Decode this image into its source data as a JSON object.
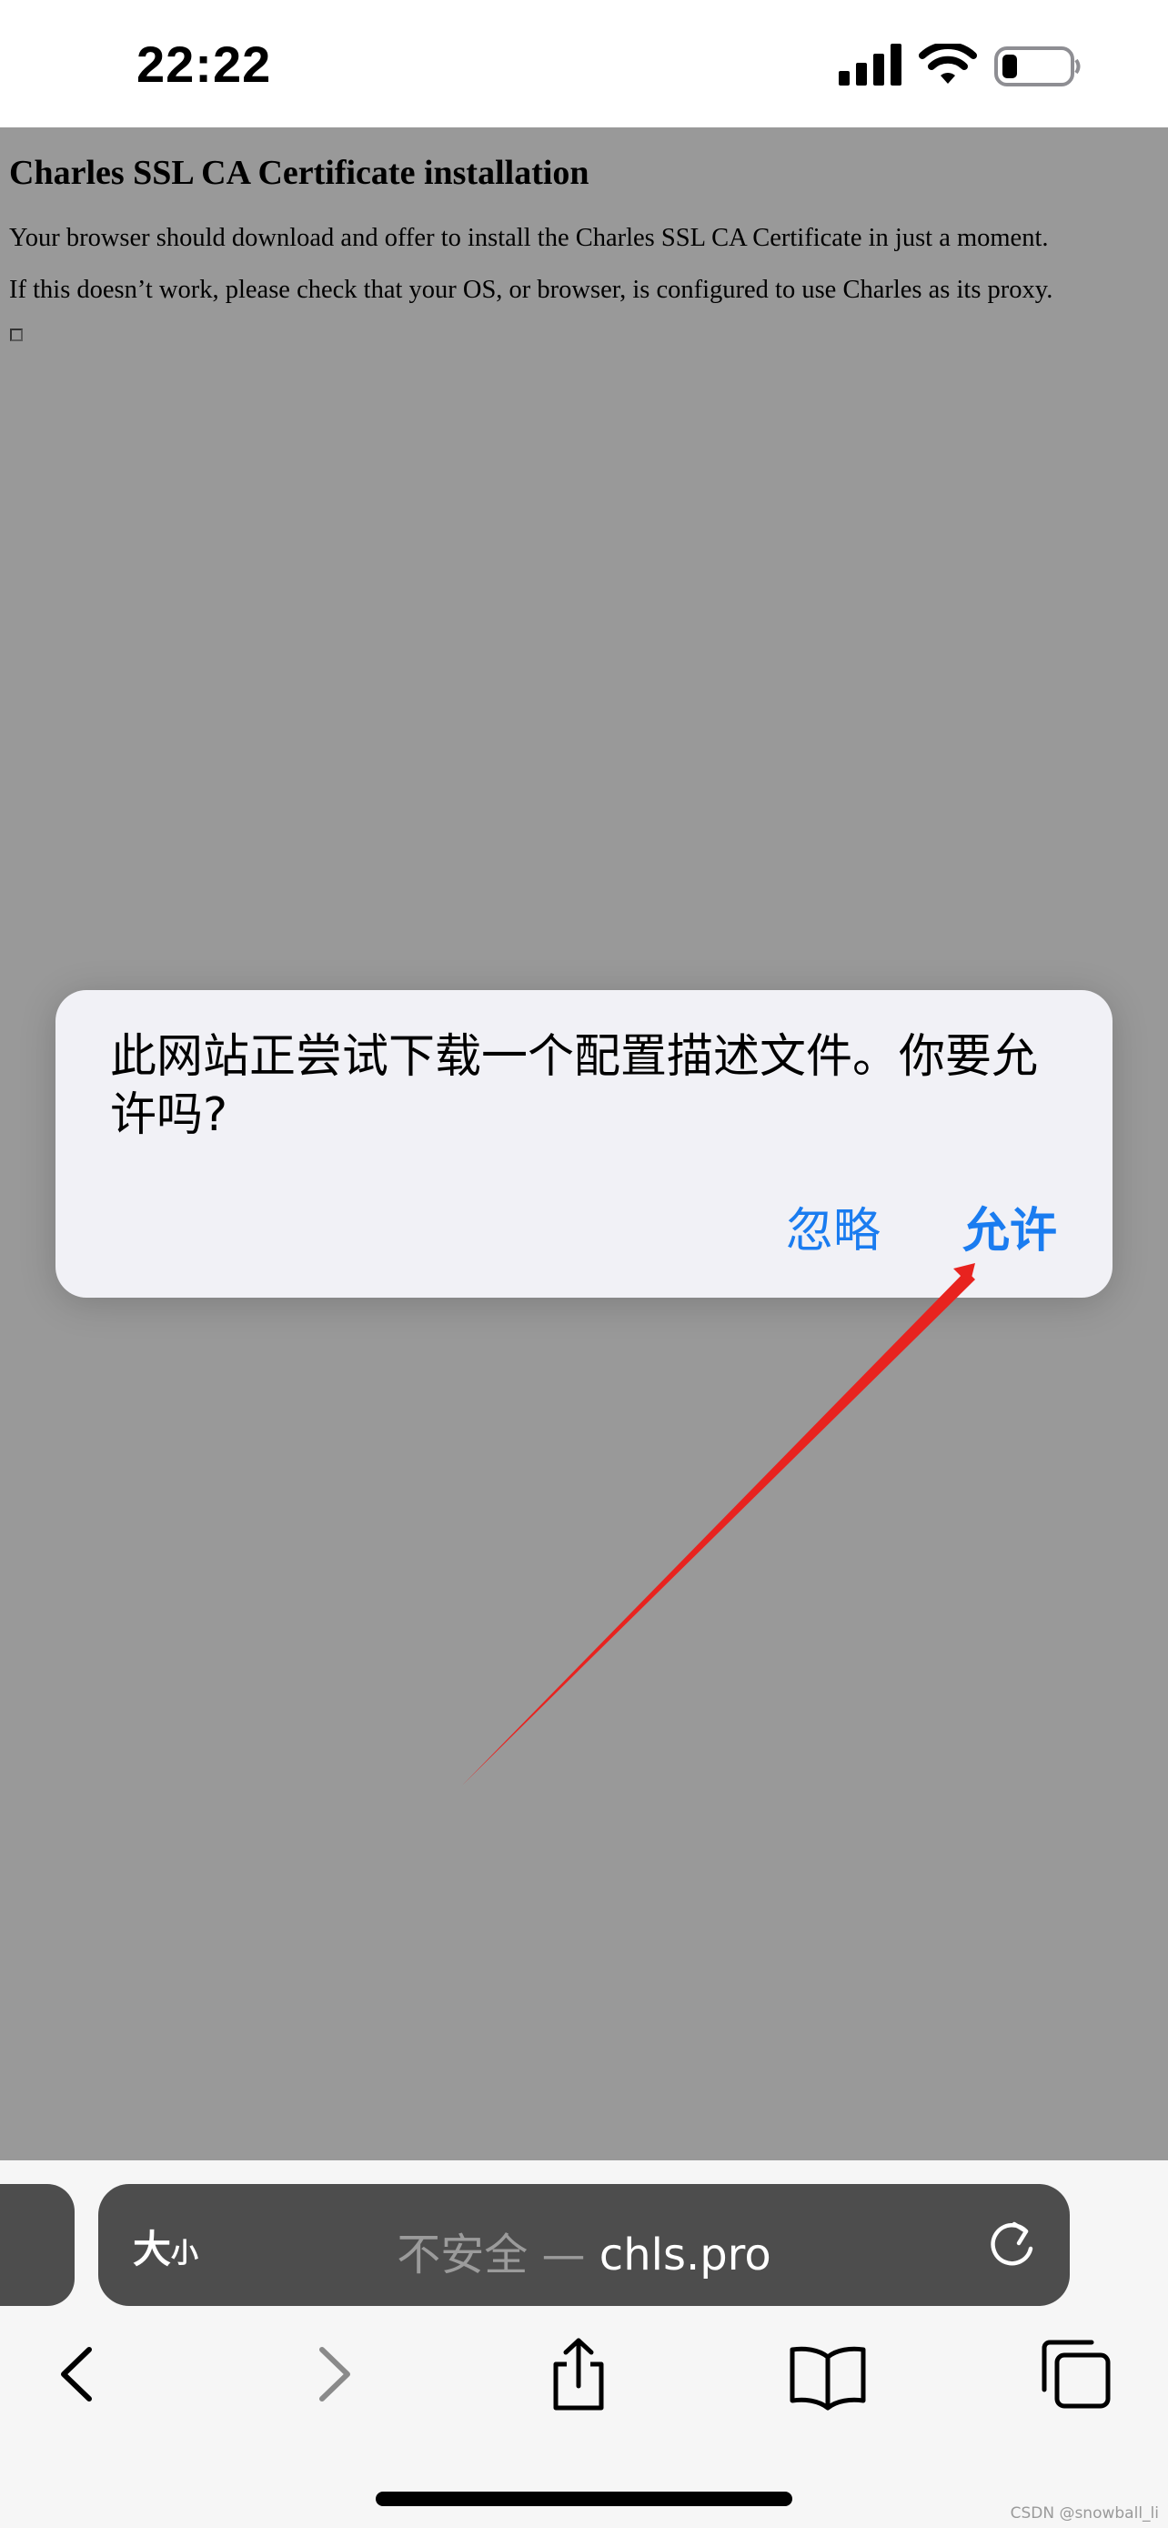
{
  "status_bar": {
    "time": "22:22",
    "icons": [
      "cellular-signal-icon",
      "wifi-icon",
      "battery-icon"
    ]
  },
  "page": {
    "heading": "Charles SSL CA Certificate installation",
    "paragraph_1": "Your browser should download and offer to install the Charles SSL CA Certificate in just a moment.",
    "paragraph_2": "If this doesn’t work, please check that your OS, or browser, is configured to use Charles as its proxy."
  },
  "alert": {
    "message": "此网站正尝试下载一个配置描述文件。你要允许吗?",
    "ignore_label": "忽略",
    "allow_label": "允许"
  },
  "address_bar": {
    "text_size_big": "大",
    "text_size_small": "小",
    "insecure_label": "不安全 — ",
    "host": "chls.pro"
  },
  "toolbar": {
    "icons": [
      "back-icon",
      "forward-icon",
      "share-icon",
      "bookmarks-icon",
      "tabs-icon"
    ]
  },
  "watermark": "CSDN @snowball_li",
  "colors": {
    "alert_button": "#1a7cf0",
    "annotation_arrow": "#e8231f",
    "overlay": "rgba(0,0,0,0.40)",
    "address_bar_bg": "#4d4d4d"
  }
}
